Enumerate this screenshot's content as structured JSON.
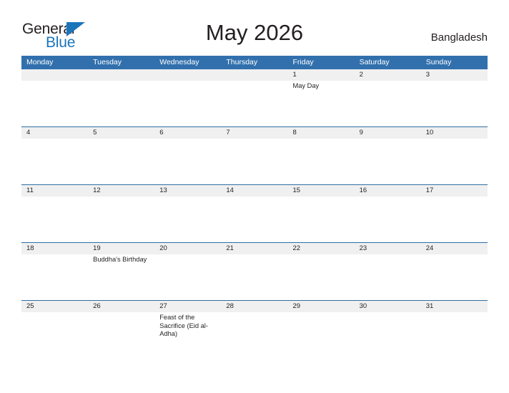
{
  "brand": {
    "name_part1": "General",
    "name_part2": "Blue",
    "accent_color": "#1b75bb",
    "flag_icon": "blue-triangle-flag-icon"
  },
  "header": {
    "title": "May 2026",
    "country": "Bangladesh"
  },
  "calendar": {
    "header_bg": "#3170ad",
    "date_band_bg": "#f0f0f0",
    "row_separator_color": "#2e6da4",
    "day_names": [
      "Monday",
      "Tuesday",
      "Wednesday",
      "Thursday",
      "Friday",
      "Saturday",
      "Sunday"
    ],
    "weeks": [
      {
        "dates": [
          "",
          "",
          "",
          "",
          "1",
          "2",
          "3"
        ],
        "events": [
          "",
          "",
          "",
          "",
          "May Day",
          "",
          ""
        ]
      },
      {
        "dates": [
          "4",
          "5",
          "6",
          "7",
          "8",
          "9",
          "10"
        ],
        "events": [
          "",
          "",
          "",
          "",
          "",
          "",
          ""
        ]
      },
      {
        "dates": [
          "11",
          "12",
          "13",
          "14",
          "15",
          "16",
          "17"
        ],
        "events": [
          "",
          "",
          "",
          "",
          "",
          "",
          ""
        ]
      },
      {
        "dates": [
          "18",
          "19",
          "20",
          "21",
          "22",
          "23",
          "24"
        ],
        "events": [
          "",
          "Buddha's Birthday",
          "",
          "",
          "",
          "",
          ""
        ]
      },
      {
        "dates": [
          "25",
          "26",
          "27",
          "28",
          "29",
          "30",
          "31"
        ],
        "events": [
          "",
          "",
          "Feast of the Sacrifice (Eid al-Adha)",
          "",
          "",
          "",
          ""
        ]
      }
    ]
  }
}
